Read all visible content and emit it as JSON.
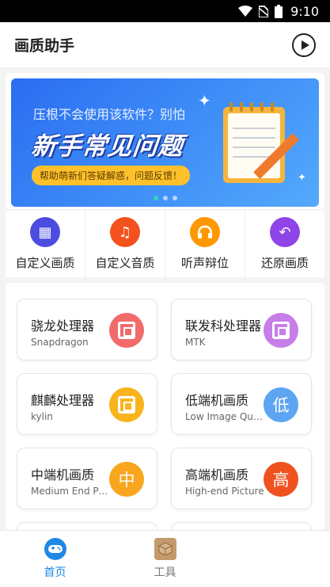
{
  "status": {
    "time": "9:10"
  },
  "appbar": {
    "title": "画质助手"
  },
  "banner": {
    "subtitle": "压根不会使用该软件？别怕",
    "headline": "新手常见问题",
    "pill": "帮助萌新们答疑解惑，问题反馈！",
    "page_count": 3,
    "active_page": 1
  },
  "quick_actions": [
    {
      "label": "自定义画质",
      "icon": "custom-quality-icon",
      "color": "#4a4de0"
    },
    {
      "label": "自定义音质",
      "icon": "music-note-icon",
      "color": "#f4511e"
    },
    {
      "label": "听声辩位",
      "icon": "headphones-icon",
      "color": "#ff9800"
    },
    {
      "label": "还原画质",
      "icon": "restore-icon",
      "color": "#8e44e6"
    }
  ],
  "cards": [
    {
      "name": "骁龙处理器",
      "en": "Snapdragon",
      "badge": "chip",
      "color": "#f26b6b"
    },
    {
      "name": "联发科处理器",
      "en": "MTK",
      "badge": "chip",
      "color": "#c77ee8"
    },
    {
      "name": "麒麟处理器",
      "en": "kylin",
      "badge": "chip",
      "color": "#f9b41d"
    },
    {
      "name": "低端机画质",
      "en": "Low Image Quality",
      "badge": "低",
      "color": "#5da5f2"
    },
    {
      "name": "中端机画质",
      "en": "Medium End Picture",
      "badge": "中",
      "color": "#f9a51d"
    },
    {
      "name": "高端机画质",
      "en": "High-end Picture",
      "badge": "高",
      "color": "#f0521f"
    }
  ],
  "tabs": [
    {
      "label": "首页",
      "icon": "gamepad-icon",
      "active": true
    },
    {
      "label": "工具",
      "icon": "toolbox-icon",
      "active": false
    }
  ]
}
